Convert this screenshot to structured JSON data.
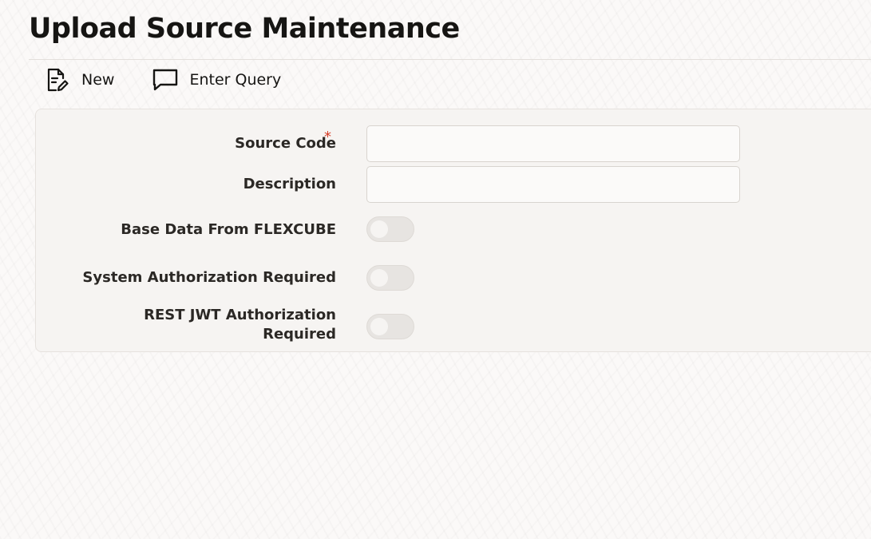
{
  "page": {
    "title": "Upload Source Maintenance"
  },
  "toolbar": {
    "new_label": "New",
    "new_icon": "document-edit-icon",
    "enter_query_label": "Enter Query",
    "enter_query_icon": "speech-bubble-icon"
  },
  "form": {
    "source_code": {
      "label": "Source Code",
      "required_marker": "*",
      "value": ""
    },
    "description": {
      "label": "Description",
      "value": ""
    },
    "base_data_from_flexcube": {
      "label": "Base Data From FLEXCUBE",
      "checked": false
    },
    "system_authorization_required": {
      "label": "System Authorization Required",
      "checked": false
    },
    "rest_jwt_authorization_required": {
      "label_line1": "REST JWT Authorization",
      "label_line2": "Required",
      "checked": false
    }
  },
  "colors": {
    "required": "#d63b25",
    "text": "#161513",
    "toggle_off": "#e7e4e1"
  }
}
